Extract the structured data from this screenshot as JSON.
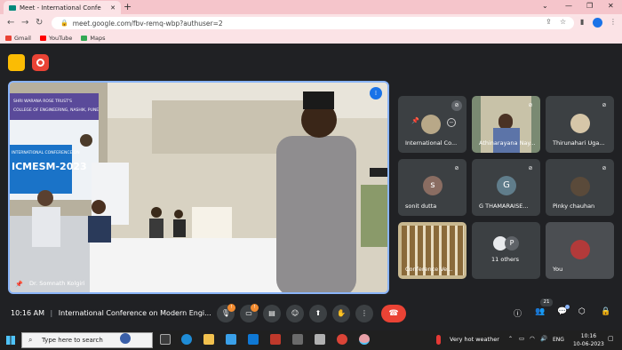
{
  "browser": {
    "tab_title": "Meet - International Confe",
    "new_tab": "+",
    "url": "meet.google.com/fbv-remq-wbp?authuser=2",
    "bookmarks": [
      {
        "label": "Gmail",
        "color": "#ea4335"
      },
      {
        "label": "YouTube",
        "color": "#ff0000"
      },
      {
        "label": "Maps",
        "color": "#34a853"
      }
    ]
  },
  "meeting": {
    "main_speaker": "Dr. Somnath Kolgiri",
    "banner_text": {
      "line1": "SHRI WARANA ROSE TRUST'S",
      "line2": "COLLEGE OF ENGINEERING, NASHIK, PUNE",
      "line3": "INTERNATIONAL CONFERENCE ON",
      "line4": "ICMESM-2023"
    },
    "tiles": [
      {
        "name": "International Co...",
        "type": "pinned",
        "muted": true
      },
      {
        "name": "Athinarayana Nay...",
        "type": "video",
        "muted": true
      },
      {
        "name": "Thirunahari Uga...",
        "type": "photo",
        "muted": true
      },
      {
        "name": "sonit dutta",
        "type": "avatar",
        "initial": "s",
        "avatar_color": "#8a6d62",
        "muted": true
      },
      {
        "name": "G THAMARAISE...",
        "type": "avatar",
        "initial": "G",
        "avatar_color": "#607d8b",
        "muted": true
      },
      {
        "name": "Pinky chauhan",
        "type": "photo",
        "muted": true
      },
      {
        "name": "Conference Ve...",
        "type": "video",
        "muted": false
      },
      {
        "name": "11 others",
        "type": "others",
        "initial": "P",
        "muted": false
      },
      {
        "name": "You",
        "type": "self",
        "muted": false
      }
    ],
    "time": "10:16 AM",
    "title": "International Conference on Modern Engi...",
    "people_count": "21",
    "mic_badge": "!",
    "cam_badge": "!"
  },
  "taskbar": {
    "search_placeholder": "Type here to search",
    "weather": "Very hot weather",
    "lang": "ENG",
    "time": "10:16",
    "date": "10-06-2023"
  },
  "colors": {
    "accent": "#8ab4f8",
    "end_call": "#ea4335",
    "browser_tint": "#f5c5cb"
  }
}
